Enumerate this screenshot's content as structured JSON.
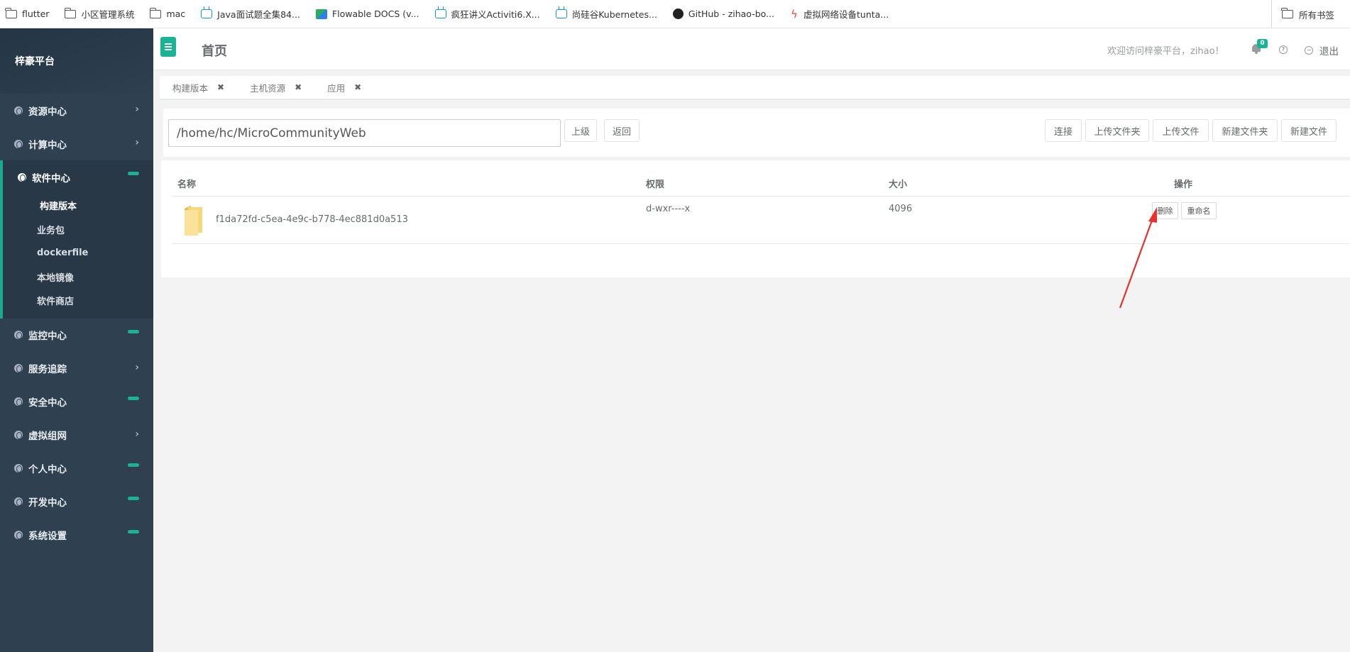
{
  "bookmarks": [
    {
      "label": "flutter",
      "icon": "folder-icon"
    },
    {
      "label": "小区管理系统",
      "icon": "folder-icon"
    },
    {
      "label": "mac",
      "icon": "folder-icon"
    },
    {
      "label": "Java面试题全集84...",
      "icon": "bilibili-icon"
    },
    {
      "label": "Flowable DOCS (v...",
      "icon": "flowable-icon"
    },
    {
      "label": "疯狂讲义Activiti6.X...",
      "icon": "bilibili-icon"
    },
    {
      "label": "尚硅谷Kubernetes...",
      "icon": "bilibili-icon"
    },
    {
      "label": "GitHub - zihao-bo...",
      "icon": "github-icon"
    },
    {
      "label": "虚拟网络设备tunta...",
      "icon": "bolt-icon"
    }
  ],
  "bookmarks_all": "所有书签",
  "sidebar": {
    "brand": "梓豪平台",
    "items": [
      {
        "label": "资源中心",
        "marker": "chevron"
      },
      {
        "label": "计算中心",
        "marker": "chevron"
      },
      {
        "label": "软件中心",
        "marker": "pill"
      },
      {
        "label": "监控中心",
        "marker": "pill"
      },
      {
        "label": "服务追踪",
        "marker": "chevron"
      },
      {
        "label": "安全中心",
        "marker": "pill"
      },
      {
        "label": "虚拟组网",
        "marker": "chevron"
      },
      {
        "label": "个人中心",
        "marker": "pill"
      },
      {
        "label": "开发中心",
        "marker": "pill"
      },
      {
        "label": "系统设置",
        "marker": "pill"
      }
    ],
    "software_sub": [
      "构建版本",
      "业务包",
      "dockerfile",
      "本地镜像",
      "软件商店"
    ],
    "chevron_glyph": "›"
  },
  "header": {
    "title": "首页",
    "welcome": "欢迎访问梓豪平台，zihao！",
    "notification_count": "0",
    "help_glyph": "?",
    "logout": "退出"
  },
  "tabs": [
    {
      "label": "构建版本"
    },
    {
      "label": "主机资源"
    },
    {
      "label": "应用"
    }
  ],
  "tab_close_glyph": "✖",
  "toolbar": {
    "path": "/home/hc/MicroCommunityWeb",
    "up": "上级",
    "back": "返回",
    "connect": "连接",
    "upload_folder": "上传文件夹",
    "upload_file": "上传文件",
    "new_folder": "新建文件夹",
    "new_file": "新建文件"
  },
  "table": {
    "headers": {
      "name": "名称",
      "perm": "权限",
      "size": "大小",
      "ops": "操作"
    },
    "rows": [
      {
        "name": "f1da72fd-c5ea-4e9c-b778-4ec881d0a513",
        "perm": "d-wxr----x",
        "size": "4096",
        "delete": "删除",
        "rename": "重命名"
      }
    ]
  },
  "colors": {
    "accent": "#1ab394",
    "sidebar": "#2f4050",
    "annotation_arrow": "#e8312b"
  }
}
